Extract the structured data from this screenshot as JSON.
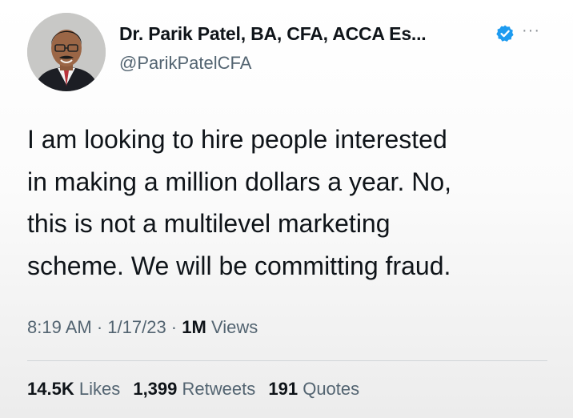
{
  "author": {
    "display_name": "Dr. Parik Patel, BA, CFA, ACCA Es...",
    "handle": "@ParikPatelCFA",
    "avatar_icon": "profile-photo",
    "verified_icon": "verified-badge-icon",
    "more_icon": "more-options-icon",
    "more_glyph": "···"
  },
  "tweet": {
    "lines": [
      "I am looking to hire people interested",
      "in making a million dollars a year. No,",
      "this is not a multilevel marketing",
      "scheme. We will be committing fraud."
    ]
  },
  "meta": {
    "time": "8:19 AM",
    "separator": " · ",
    "date": "1/17/23",
    "views_count": "1M",
    "views_label": "Views"
  },
  "stats": {
    "likes_count": "14.5K",
    "likes_label": "Likes",
    "retweets_count": "1,399",
    "retweets_label": "Retweets",
    "quotes_count": "191",
    "quotes_label": "Quotes"
  },
  "colors": {
    "text_primary": "#0f1419",
    "text_secondary": "#536471",
    "verified_blue": "#1d9bf0"
  }
}
